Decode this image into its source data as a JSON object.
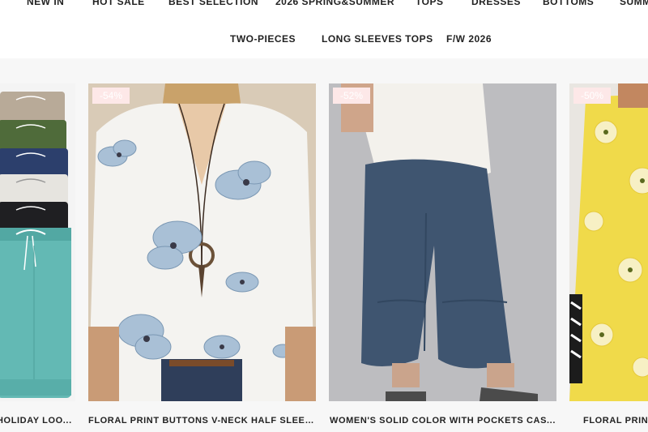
{
  "nav": {
    "row1": [
      "NEW IN",
      "HOT SALE",
      "BEST SELECTION",
      "2026 SPRING&SUMMER",
      "TOPS",
      "DRESSES",
      "BOTTOMS",
      "SUMM"
    ],
    "row2": [
      "TWO-PIECES",
      "LONG SLEEVES TOPS",
      "F/W 2026"
    ]
  },
  "products": [
    {
      "title": "HOLIDAY LOO...",
      "discount": "",
      "image": "stacked shorts in multiple colors"
    },
    {
      "title": "FLORAL PRINT BUTTONS V-NECK HALF SLEEV...",
      "discount": "-54%",
      "image": "white floral blouse"
    },
    {
      "title": "WOMEN'S SOLID COLOR WITH POCKETS CAS...",
      "discount": "-52%",
      "image": "navy cropped pants"
    },
    {
      "title": "FLORAL PRINT",
      "discount": "-50%",
      "image": "yellow floral top"
    }
  ],
  "colors": {
    "badge_bg": "#fde8e8",
    "badge_text": "#ffffff",
    "nav_bg": "#ffffff",
    "page_bg": "#f7f7f7"
  }
}
